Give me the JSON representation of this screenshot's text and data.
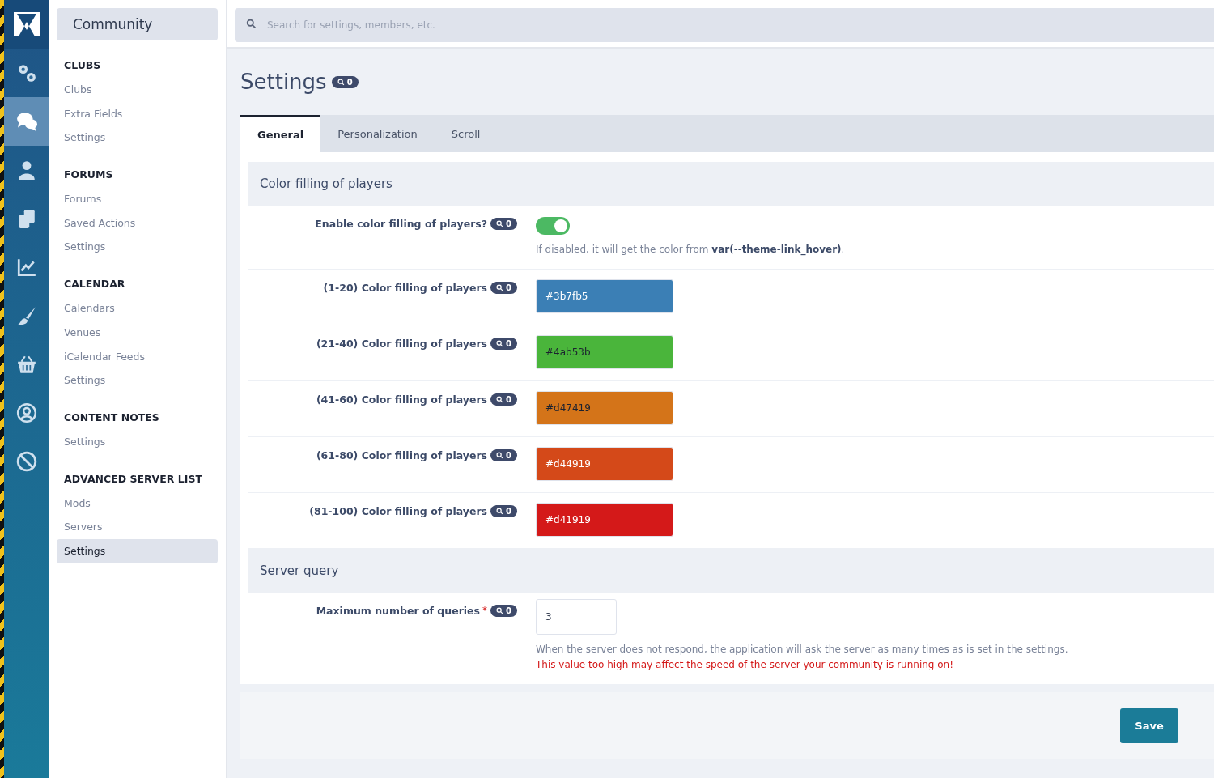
{
  "rail": {
    "items": [
      {
        "selected": false
      },
      {
        "selected": true
      },
      {
        "selected": false
      },
      {
        "selected": false
      },
      {
        "selected": false
      },
      {
        "selected": false
      },
      {
        "selected": false
      },
      {
        "selected": false
      },
      {
        "selected": false
      }
    ]
  },
  "sidebar": {
    "title": "Community",
    "sections": [
      {
        "heading": "CLUBS",
        "items": [
          {
            "label": "Clubs",
            "selected": false
          },
          {
            "label": "Extra Fields",
            "selected": false
          },
          {
            "label": "Settings",
            "selected": false
          }
        ]
      },
      {
        "heading": "FORUMS",
        "items": [
          {
            "label": "Forums",
            "selected": false
          },
          {
            "label": "Saved Actions",
            "selected": false
          },
          {
            "label": "Settings",
            "selected": false
          }
        ]
      },
      {
        "heading": "CALENDAR",
        "items": [
          {
            "label": "Calendars",
            "selected": false
          },
          {
            "label": "Venues",
            "selected": false
          },
          {
            "label": "iCalendar Feeds",
            "selected": false
          },
          {
            "label": "Settings",
            "selected": false
          }
        ]
      },
      {
        "heading": "CONTENT NOTES",
        "items": [
          {
            "label": "Settings",
            "selected": false
          }
        ]
      },
      {
        "heading": "ADVANCED SERVER LIST",
        "items": [
          {
            "label": "Mods",
            "selected": false
          },
          {
            "label": "Servers",
            "selected": false
          },
          {
            "label": "Settings",
            "selected": true
          }
        ]
      }
    ]
  },
  "search": {
    "placeholder": "Search for settings, members, etc."
  },
  "page": {
    "title": "Settings",
    "badge": "0"
  },
  "tabs": [
    {
      "label": "General",
      "selected": true
    },
    {
      "label": "Personalization",
      "selected": false
    },
    {
      "label": "Scroll",
      "selected": false
    }
  ],
  "sections": [
    {
      "title": "Color filling of players",
      "rows": [
        {
          "kind": "toggle",
          "label": "Enable color filling of players?",
          "badge": "0",
          "on": true,
          "hint": "If disabled, it will get the color from **var(--theme-link_hover)**."
        },
        {
          "kind": "color",
          "label": "(1-20) Color filling of players",
          "badge": "0",
          "value": "#3b7fb5",
          "color": "#3b7fb5"
        },
        {
          "kind": "color",
          "label": "(21-40) Color filling of players",
          "badge": "0",
          "value": "#4ab53b",
          "color": "#4ab53b"
        },
        {
          "kind": "color",
          "label": "(41-60) Color filling of players",
          "badge": "0",
          "value": "#d47419",
          "color": "#d47419"
        },
        {
          "kind": "color",
          "label": "(61-80) Color filling of players",
          "badge": "0",
          "value": "#d44919",
          "color": "#d44919"
        },
        {
          "kind": "color",
          "label": "(81-100) Color filling of players",
          "badge": "0",
          "value": "#d41919",
          "color": "#d41919"
        }
      ]
    },
    {
      "title": "Server query",
      "rows": [
        {
          "kind": "number",
          "label": "Maximum number of queries",
          "required": "*",
          "badge": "0",
          "value": "3",
          "hint": "When the server does not respond, the application will ask the server as many times as is set in the settings.",
          "warning": "This value too high may affect the speed of the server your community is running on!"
        }
      ]
    }
  ],
  "save_button": "Save"
}
